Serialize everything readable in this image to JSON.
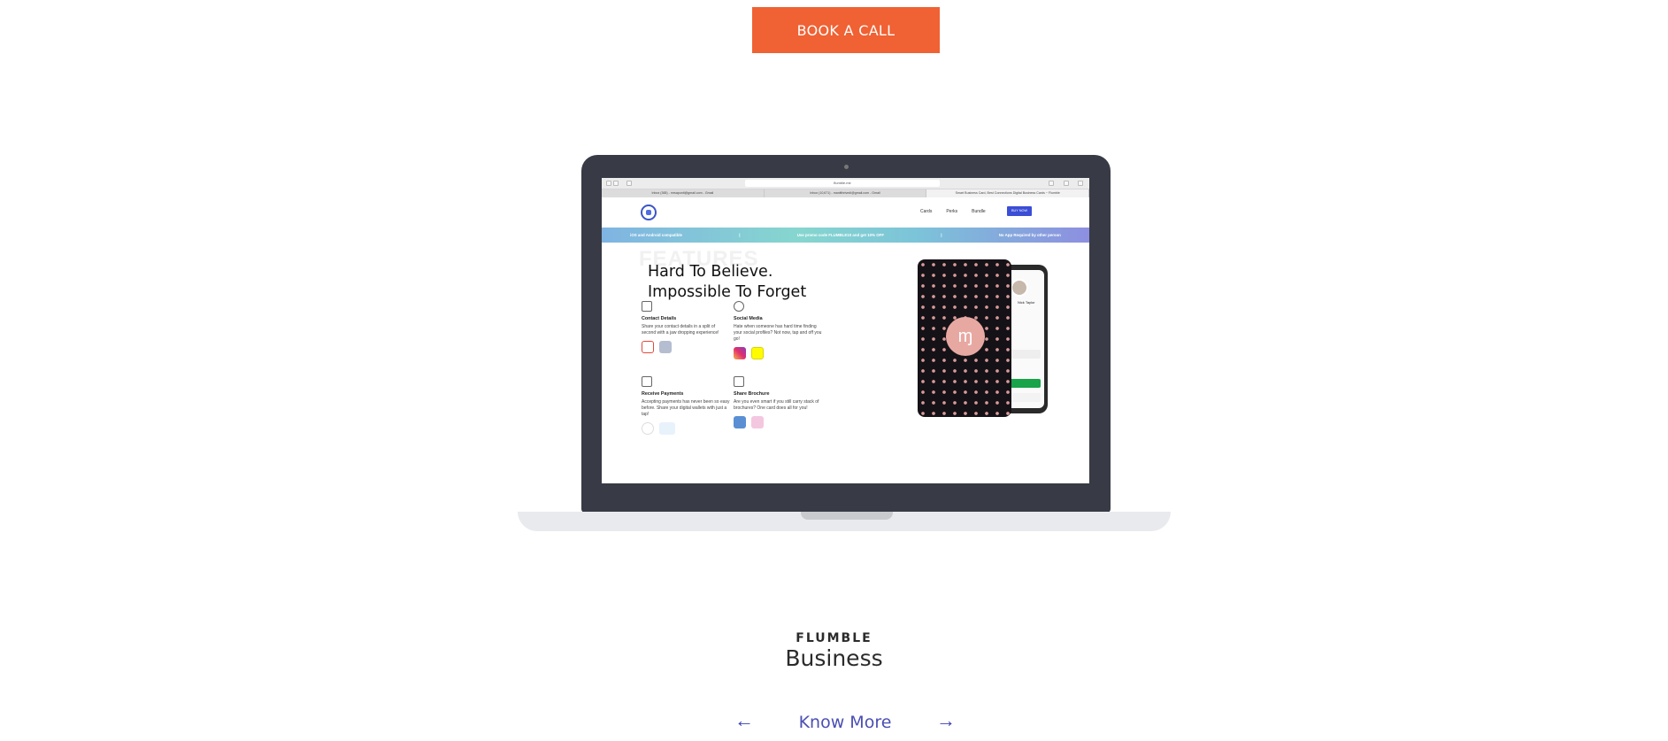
{
  "cta": {
    "book_call": "BOOK A CALL"
  },
  "browser": {
    "url": "flumble.me",
    "tabs": [
      "Inbox (365) - mrsapunit@gmail.com - Gmail",
      "Inbox (10,671) - manitthrivedi@gmail.com - Gmail",
      "Smart Business Card, Best Connections Digital Business Cards ~ Flumble"
    ]
  },
  "site": {
    "nav": [
      "Cards",
      "Perks",
      "Bundle"
    ],
    "buy_now": "BUY NOW",
    "promo": [
      "iOS and Android compatible",
      "|",
      "Use promo code FLUMBLE10 and get 10% OFF",
      "|",
      "No App Required by other person"
    ],
    "ghost_heading": "FEATURES",
    "headline_line1": "Hard To Believe.",
    "headline_line2": "Impossible To Forget",
    "features": [
      {
        "title": "Contact Details",
        "desc": "Share your contact details in a split of second with a jaw dropping experience!"
      },
      {
        "title": "Social Media",
        "desc": "Hate when someone has hard time finding your social profiles? Not now, tap and off you go!"
      },
      {
        "title": "Receive Payments",
        "desc": "Accepting payments has never been so easy before. Share your digital wallets with just a tap!"
      },
      {
        "title": "Share Brochure",
        "desc": "Are you even smart if you still carry stack of brochures? One card does all for you!"
      }
    ],
    "phone_name": "Nick Taylor"
  },
  "showcase": {
    "brand": "FLUMBLE",
    "product": "Business",
    "know_more": "Know More",
    "prev_icon": "←",
    "next_icon": "→"
  },
  "colors": {
    "cta": "#f06133",
    "link": "#4a4fb3",
    "laptop": "#383b45"
  }
}
